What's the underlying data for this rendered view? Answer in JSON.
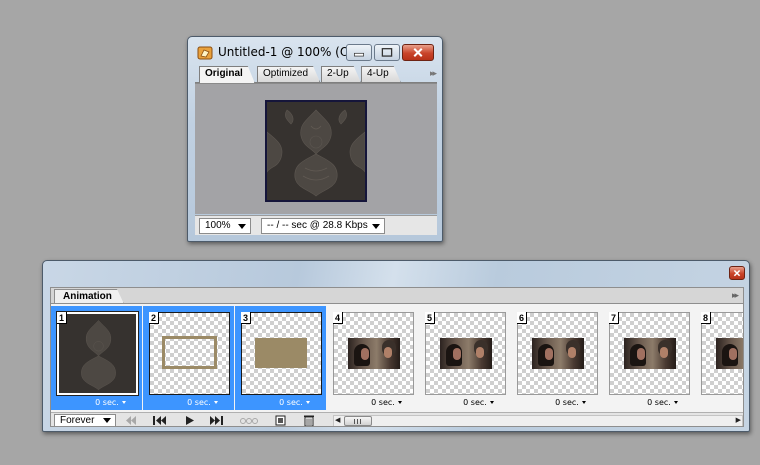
{
  "image_window": {
    "title": "Untitled-1 @ 100% (O...",
    "tabs": [
      "Original",
      "Optimized",
      "2-Up",
      "4-Up"
    ],
    "active_tab": "Original",
    "zoom": "100%",
    "speed": "-- / -- sec @ 28.8 Kbps"
  },
  "animation_palette": {
    "tab_label": "Animation",
    "loop_option": "Forever",
    "frames": [
      {
        "number": "1",
        "delay": "0 sec.",
        "selected": true,
        "content": "damask-texture"
      },
      {
        "number": "2",
        "delay": "0 sec.",
        "selected": true,
        "content": "outline-rectangle"
      },
      {
        "number": "3",
        "delay": "0 sec.",
        "selected": true,
        "content": "filled-rectangle"
      },
      {
        "number": "4",
        "delay": "0 sec.",
        "selected": false,
        "content": "photo-frame"
      },
      {
        "number": "5",
        "delay": "0 sec.",
        "selected": false,
        "content": "photo-frame"
      },
      {
        "number": "6",
        "delay": "0 sec.",
        "selected": false,
        "content": "photo-frame"
      },
      {
        "number": "7",
        "delay": "0 sec.",
        "selected": false,
        "content": "photo-frame"
      },
      {
        "number": "8",
        "delay": "",
        "selected": false,
        "content": "photo-frame"
      }
    ]
  },
  "colors": {
    "selection": "#3d95ff",
    "rect_color": "#9b8a66",
    "close_red": "#c9442a"
  },
  "icons": {
    "app": "photoshop-icon",
    "minimize": "minimize-icon",
    "maximize": "maximize-icon",
    "close": "close-icon",
    "first_frame": "first-frame-icon",
    "prev_frame": "previous-frame-icon",
    "play": "play-icon",
    "next_frame": "next-frame-icon",
    "tween": "tween-icon",
    "duplicate": "duplicate-frame-icon",
    "delete": "trash-icon"
  }
}
